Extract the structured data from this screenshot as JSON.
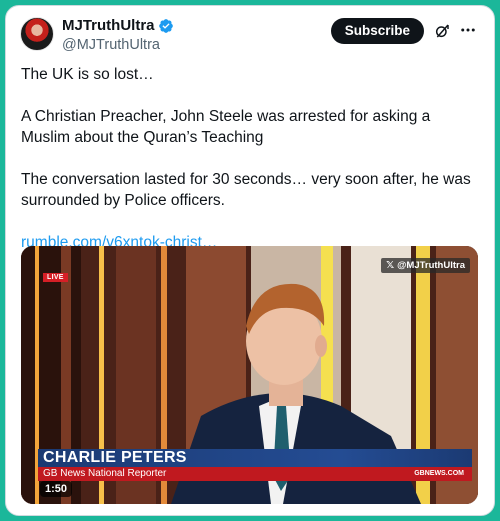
{
  "author": {
    "display_name": "MJTruthUltra",
    "handle": "@MJTruthUltra",
    "verified": true,
    "avatar_icon": "avatar-image"
  },
  "actions": {
    "subscribe_label": "Subscribe",
    "grok_icon": "grok-icon",
    "more_icon": "more-icon"
  },
  "tweet": {
    "paragraphs": [
      "The UK is so lost…",
      "A Christian Preacher, John Steele was arrested for asking a Muslim about the Quran’s Teaching",
      "The conversation lasted for 30 seconds… very soon after, he was surrounded by Police officers."
    ],
    "link": "rumble.com/v6xntok-christ…"
  },
  "media": {
    "live_label": "LIVE",
    "watermark": "@MJTruthUltra",
    "reporter_name": "CHARLIE PETERS",
    "reporter_role": "GB News National Reporter",
    "channel_tag": "GBNEWS.COM",
    "duration": "1:50"
  },
  "colors": {
    "page_background": "#1bb79a",
    "link": "#1d9bf0",
    "verified_badge": "#1d9bf0",
    "lower_third_blue": "#1b3a73",
    "lower_third_red": "#c0191f"
  }
}
